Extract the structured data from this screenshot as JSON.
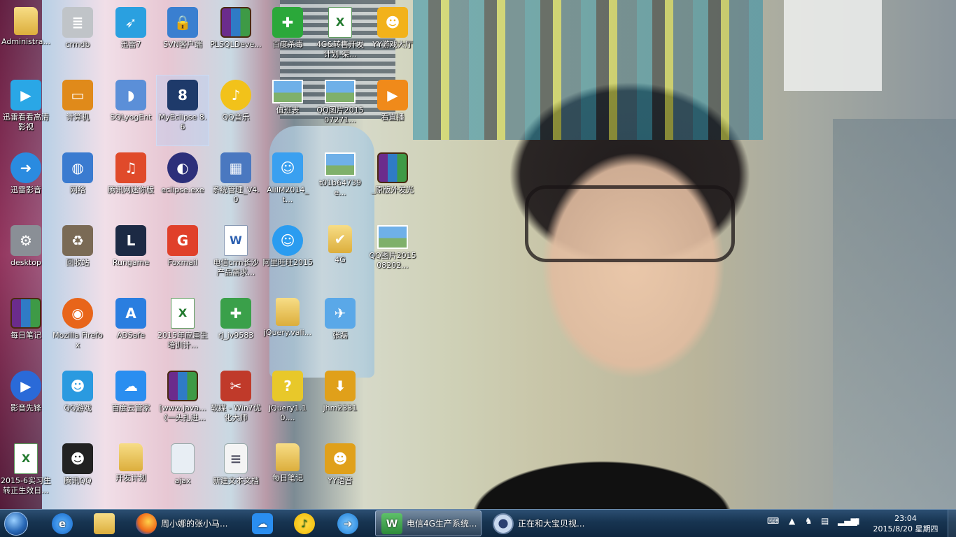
{
  "desktop": {
    "icons": [
      {
        "label": "Administra...",
        "icon": "folder-user-icon"
      },
      {
        "label": "crmdb",
        "icon": "database-icon"
      },
      {
        "label": "迅雷7",
        "icon": "thunder-bird-icon"
      },
      {
        "label": "SVN客户端",
        "icon": "shield-lock-icon"
      },
      {
        "label": "PLSQLDeve...",
        "icon": "winrar-icon"
      },
      {
        "label": "百度杀毒",
        "icon": "baidu-antivirus-icon"
      },
      {
        "label": "4G&转售开发计划-渠...",
        "icon": "excel-file-icon"
      },
      {
        "label": "YY游戏大厅",
        "icon": "yy-game-icon"
      },
      {
        "label": "迅雷看看高清影视",
        "icon": "xunlei-kankan-icon"
      },
      {
        "label": "计算机",
        "icon": "computer-icon"
      },
      {
        "label": "SQLyogEnt",
        "icon": "dolphin-icon"
      },
      {
        "label": "MyEclipse 8.6",
        "icon": "myeclipse-icon"
      },
      {
        "label": "QQ音乐",
        "icon": "qq-music-icon"
      },
      {
        "label": "值班表",
        "icon": "image-file-icon"
      },
      {
        "label": "QQ图片201507271...",
        "icon": "image-file-icon"
      },
      {
        "label": "看直播",
        "icon": "live-tv-icon"
      },
      {
        "label": "迅雷影音",
        "icon": "xunlei-player-icon"
      },
      {
        "label": "网络",
        "icon": "network-icon"
      },
      {
        "label": "腾讯网迷你版",
        "icon": "tencent-mini-icon"
      },
      {
        "label": "eclipse.exe",
        "icon": "eclipse-icon"
      },
      {
        "label": "系统管理_V4.0",
        "icon": "system-manage-icon"
      },
      {
        "label": "AliIM2014_t...",
        "icon": "aliwangwang-installer-icon"
      },
      {
        "label": "t01b64739e...",
        "icon": "image-file-icon"
      },
      {
        "label": "_原版外发光",
        "icon": "winrar-icon"
      },
      {
        "label": "desktop",
        "icon": "gear-file-icon"
      },
      {
        "label": "回收站",
        "icon": "recycle-bin-icon"
      },
      {
        "label": "Rungame",
        "icon": "rungame-icon"
      },
      {
        "label": "Foxmail",
        "icon": "foxmail-icon"
      },
      {
        "label": "电信crm长沙产品需求...",
        "icon": "word-file-icon"
      },
      {
        "label": "阿里旺旺2015",
        "icon": "aliwangwang-icon"
      },
      {
        "label": "4G",
        "icon": "folder-check-icon"
      },
      {
        "label": "QQ图片201508202...",
        "icon": "image-file-icon"
      },
      {
        "label": "每日笔记",
        "icon": "winrar-icon"
      },
      {
        "label": "Mozilla Firefox",
        "icon": "firefox-icon"
      },
      {
        "label": "ADSafe",
        "icon": "adsafe-icon"
      },
      {
        "label": "2015年应届生培训计...",
        "icon": "excel-file-icon"
      },
      {
        "label": "rj_jv9583",
        "icon": "green-package-icon"
      },
      {
        "label": "jQuery.vali...",
        "icon": "folder-icon"
      },
      {
        "label": "张磊",
        "icon": "paper-plane-file-icon"
      },
      {
        "label": "影音先锋",
        "icon": "media-player-icon"
      },
      {
        "label": "QQ游戏",
        "icon": "qq-game-icon"
      },
      {
        "label": "百度云管家",
        "icon": "baidu-cloud-icon"
      },
      {
        "label": "[www.java...《一头扎进...",
        "icon": "winrar-icon"
      },
      {
        "label": "软媒 - Win7优化大师",
        "icon": "win7-optimizer-icon"
      },
      {
        "label": "jQuery1.10....",
        "icon": "help-file-icon"
      },
      {
        "label": "jhm2331",
        "icon": "yy-installer-icon"
      },
      {
        "label": "2015-6实习生转正生效日...",
        "icon": "excel-file-icon"
      },
      {
        "label": "腾讯QQ",
        "icon": "qq-penguin-icon"
      },
      {
        "label": "开发计划",
        "icon": "folder-icon"
      },
      {
        "label": "ajax",
        "icon": "blank-file-icon"
      },
      {
        "label": "新建文本文档",
        "icon": "text-file-icon"
      },
      {
        "label": "每日笔记",
        "icon": "folder-icon"
      },
      {
        "label": "YY语音",
        "icon": "yy-voice-icon"
      }
    ]
  },
  "taskbar": {
    "start_icon": "windows-start-icon",
    "pinned": [
      {
        "name": "ie",
        "icon": "internet-explorer-icon"
      },
      {
        "name": "explorer",
        "icon": "file-explorer-icon"
      }
    ],
    "tasks": [
      {
        "label": "周小娜的张小马...",
        "icon": "firefox-icon"
      },
      {
        "label": "",
        "icon": "baidu-cloud-icon"
      },
      {
        "label": "",
        "icon": "qq-music-icon"
      },
      {
        "label": "",
        "icon": "xunlei-player-icon"
      },
      {
        "label": "电信4G生产系统...",
        "icon": "myeclipse-icon"
      },
      {
        "label": "正在和大宝贝视...",
        "icon": "webcam-icon"
      }
    ],
    "clock": {
      "time": "23:04",
      "date": "2015/8/20 星期四"
    }
  },
  "colors": {
    "taskbar": "#173451",
    "accent": "#2a6ab8",
    "folder": "#e8c45a"
  }
}
